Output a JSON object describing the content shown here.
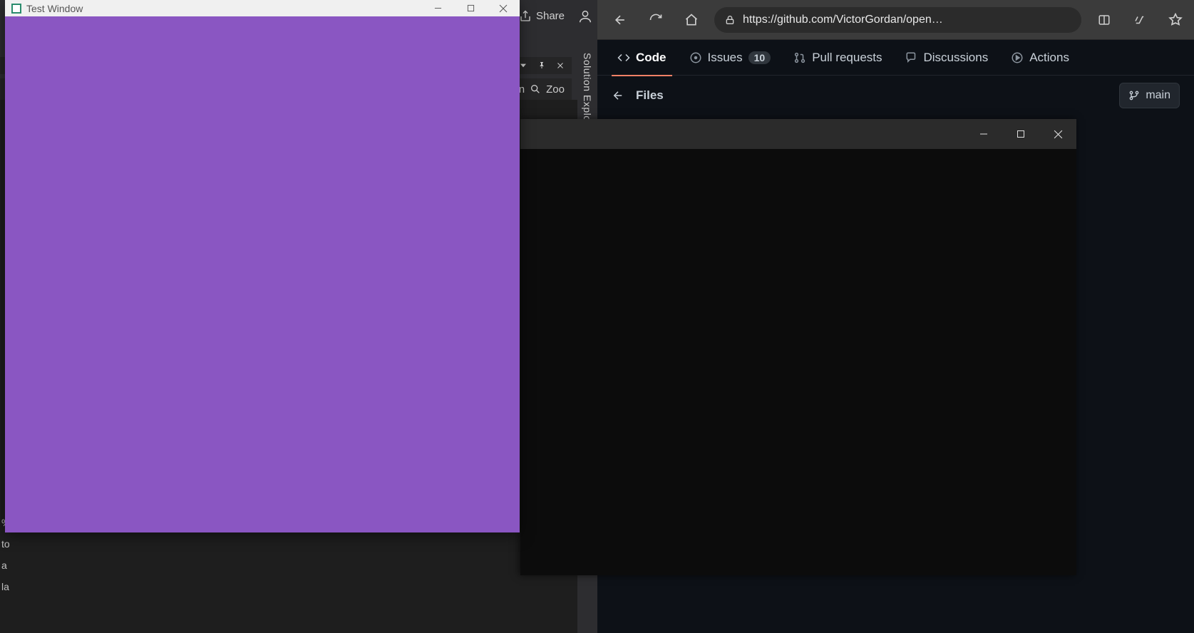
{
  "vs": {
    "share_label": "Share",
    "zoom_in_text": "In",
    "zoom_label": "Zoo",
    "side_tab": "Solution Explo",
    "left_fragments": [
      "%",
      "to",
      "a",
      "la"
    ]
  },
  "glwin": {
    "title": "Test Window",
    "clear_color": "#8a56c2"
  },
  "edge": {
    "url": "https://github.com/VictorGordan/open…"
  },
  "github": {
    "tabs": {
      "code": "Code",
      "issues": "Issues",
      "issues_count": "10",
      "pulls": "Pull requests",
      "discussions": "Discussions",
      "actions": "Actions"
    },
    "files_label": "Files",
    "branch": "main"
  }
}
